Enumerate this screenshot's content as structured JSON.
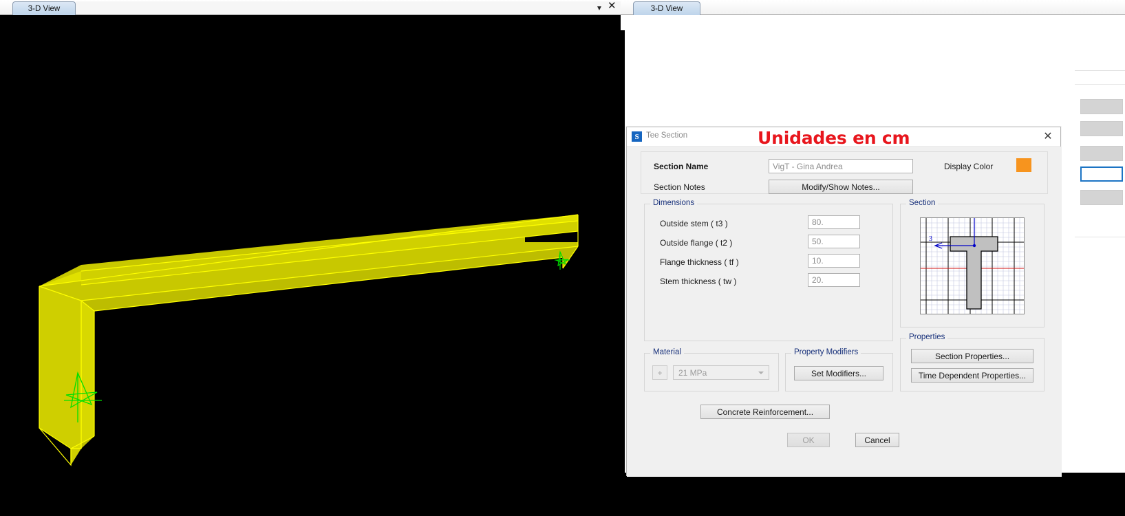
{
  "left_window": {
    "tab_label": "3-D View",
    "dropdown_icon": "chevron-down-icon",
    "close_icon": "close-icon",
    "viewport_description": "3-D wireframe view of an extruded concrete T-beam rendered in yellow on a black background, with green local-axes markers at each end."
  },
  "right_window": {
    "tab_label": "3-D View"
  },
  "dialog": {
    "icon_letter": "S",
    "title": "Tee Section",
    "annotation": "Unidades en cm",
    "close_icon": "close-icon",
    "section_name_label": "Section Name",
    "section_name_value": "VigT - Gina Andrea",
    "section_notes_label": "Section Notes",
    "modify_show_notes_label": "Modify/Show Notes...",
    "display_color_label": "Display Color",
    "display_color_value": "#f7941e",
    "dimensions": {
      "group_title": "Dimensions",
      "rows": [
        {
          "label": "Outside stem  ( t3 )",
          "value": "80."
        },
        {
          "label": "Outside flange  ( t2 )",
          "value": "50."
        },
        {
          "label": "Flange thickness  ( tf )",
          "value": "10."
        },
        {
          "label": "Stem thickness  ( tw )",
          "value": "20."
        }
      ]
    },
    "section_group": {
      "group_title": "Section",
      "axis_label": "3",
      "shape": "tee-section",
      "fill_color": "#c0c0c0",
      "grid_color": "#b8bcd8",
      "centerline_color": "#d01010",
      "axis_color": "#0000c8"
    },
    "material": {
      "group_title": "Material",
      "add_button_label": "+",
      "selected_value": "21 MPa"
    },
    "property_modifiers": {
      "group_title": "Property Modifiers",
      "set_modifiers_label": "Set Modifiers..."
    },
    "properties": {
      "group_title": "Properties",
      "section_properties_label": "Section Properties...",
      "time_dependent_label": "Time Dependent Properties..."
    },
    "concrete_reinforcement_label": "Concrete Reinforcement...",
    "ok_label": "OK",
    "cancel_label": "Cancel"
  }
}
